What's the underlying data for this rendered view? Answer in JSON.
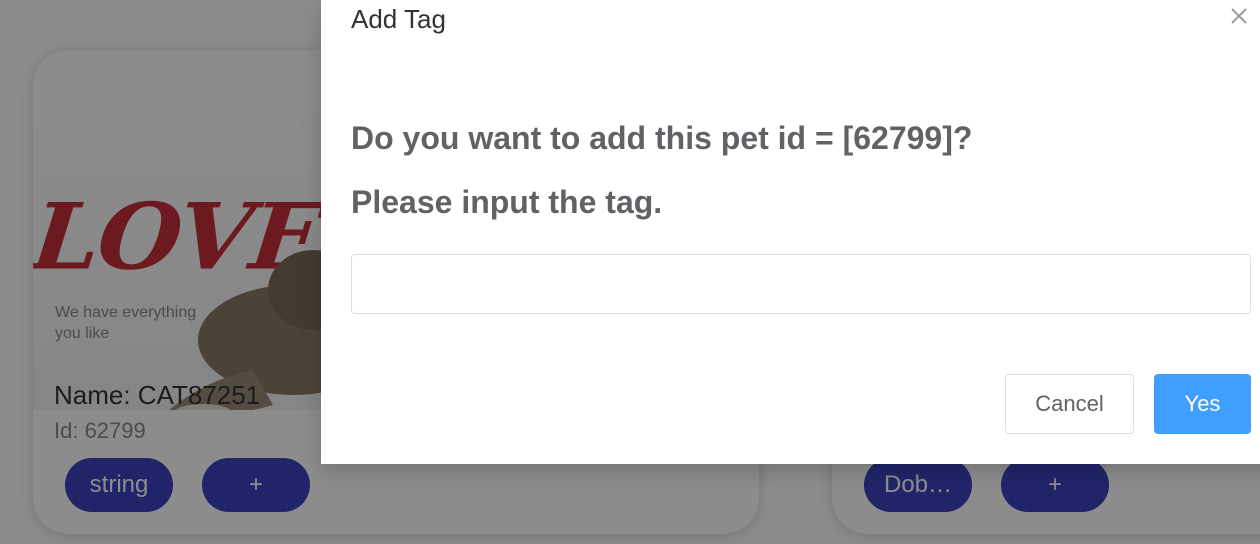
{
  "colors": {
    "mask": "#000000",
    "pill": "#3d43bf",
    "primary_button": "#409eff",
    "love_text": "#c5303b"
  },
  "background": {
    "cards": [
      {
        "image": {
          "headline": "LOVE A",
          "tagline": "We have everything you like",
          "illustration": "cat-photo"
        },
        "name_line": "Name: CAT87251",
        "id_line": "Id: 62799",
        "tag_label": "string",
        "add_label": "+"
      },
      {
        "tag_label": "Dob…",
        "add_label": "+"
      }
    ]
  },
  "modal": {
    "title": "Add Tag",
    "close_icon": "close-icon",
    "question": "Do you want to add this pet id = [62799]?",
    "instruction": "Please input the tag.",
    "input": {
      "value": "",
      "placeholder": ""
    },
    "cancel_label": "Cancel",
    "confirm_label": "Yes"
  }
}
